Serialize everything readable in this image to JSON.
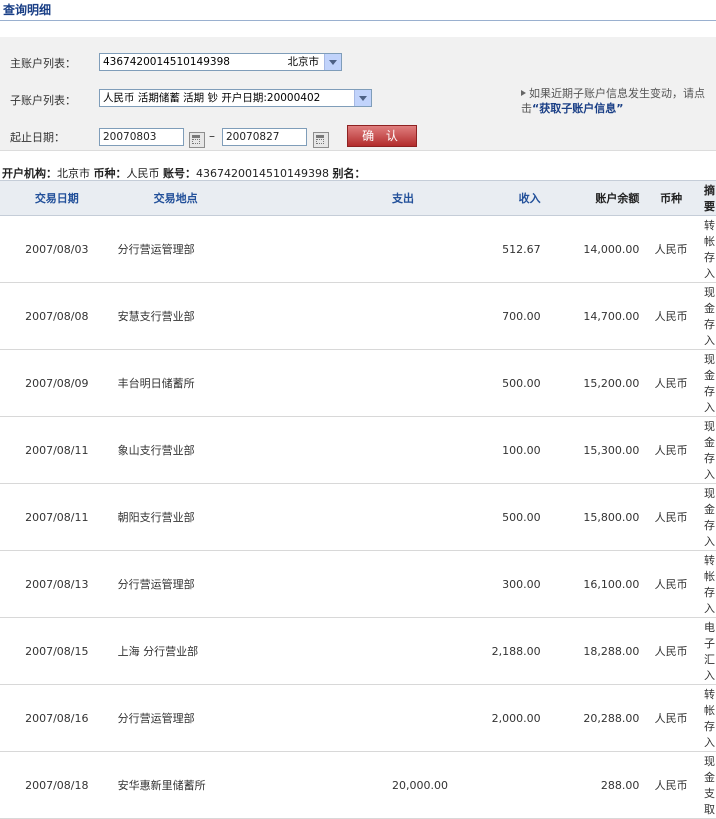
{
  "page_title": "查询明细",
  "filters": {
    "main_account_label": "主账户列表：",
    "main_account_value": "4367420014510149398",
    "main_account_city": "北京市",
    "sub_account_label": "子账户列表：",
    "sub_account_value": "人民币 活期储蓄 活期 钞 开户日期:20000402",
    "date_label": "起止日期：",
    "start_date": "20070803",
    "date_separator": "–",
    "end_date": "20070827",
    "confirm_label": "确 认",
    "note_line1": "如果近期子账户信息发生变动，请点",
    "note_prefix": "击",
    "note_link": "“获取子账户信息”"
  },
  "account_info": {
    "branch_label": "开户机构：",
    "branch_value": "北京市",
    "currency_label": "币种：",
    "currency_value": "人民币",
    "account_label": "账号：",
    "account_value": "4367420014510149398",
    "alias_label": "别名："
  },
  "table": {
    "headers": [
      "交易日期",
      "交易地点",
      "支出",
      "收入",
      "账户余额",
      "币种",
      "摘要"
    ],
    "rows": [
      [
        "2007/08/03",
        "分行营运管理部",
        "",
        "512.67",
        "14,000.00",
        "人民币",
        "转帐存入"
      ],
      [
        "2007/08/08",
        "安慧支行营业部",
        "",
        "700.00",
        "14,700.00",
        "人民币",
        "现金存入"
      ],
      [
        "2007/08/09",
        "丰台明日储蓄所",
        "",
        "500.00",
        "15,200.00",
        "人民币",
        "现金存入"
      ],
      [
        "2007/08/11",
        "象山支行营业部",
        "",
        "100.00",
        "15,300.00",
        "人民币",
        "现金存入"
      ],
      [
        "2007/08/11",
        "朝阳支行营业部",
        "",
        "500.00",
        "15,800.00",
        "人民币",
        "现金存入"
      ],
      [
        "2007/08/13",
        "分行营运管理部",
        "",
        "300.00",
        "16,100.00",
        "人民币",
        "转帐存入"
      ],
      [
        "2007/08/15",
        "上海 分行营业部",
        "",
        "2,188.00",
        "18,288.00",
        "人民币",
        "电子汇入"
      ],
      [
        "2007/08/16",
        "分行营运管理部",
        "",
        "2,000.00",
        "20,288.00",
        "人民币",
        "转帐存入"
      ],
      [
        "2007/08/18",
        "安华惠新里储蓄所",
        "20,000.00",
        "",
        "288.00",
        "人民币",
        "现金支取"
      ]
    ]
  }
}
